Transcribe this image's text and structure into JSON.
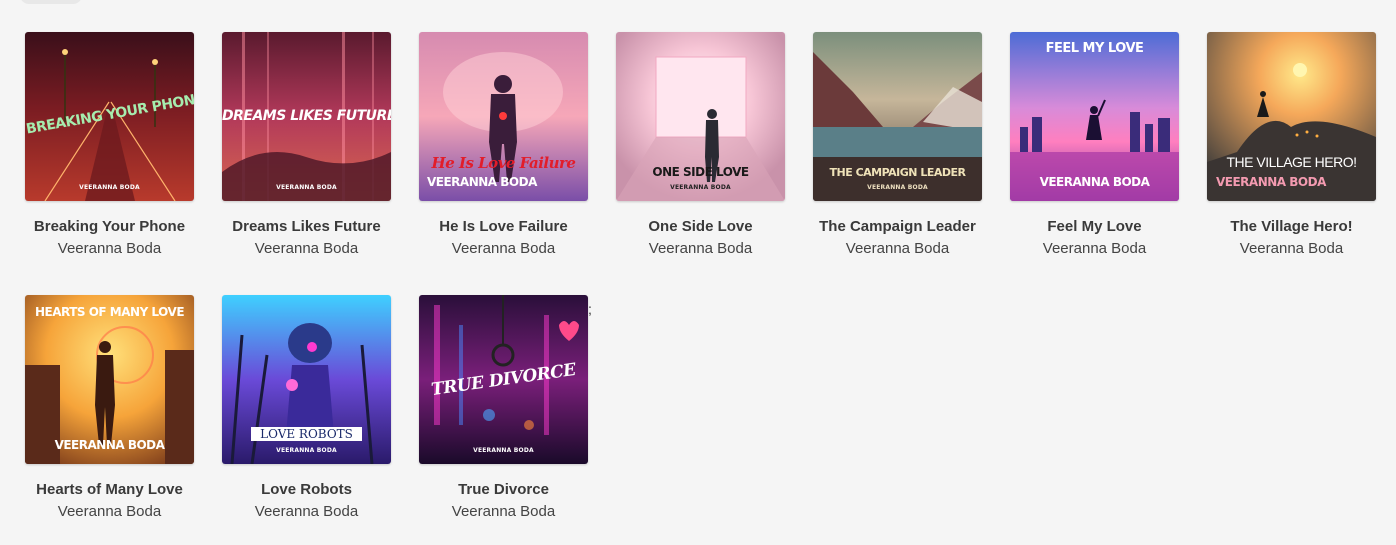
{
  "albums": [
    {
      "title": "Breaking Your Phone",
      "artist": "Veeranna Boda",
      "cover_text": "BREAKING YOUR PHONE",
      "cover_artist": "VEERANNA BODA"
    },
    {
      "title": "Dreams Likes Future",
      "artist": "Veeranna Boda",
      "cover_text": "DREAMS LIKES FUTURE",
      "cover_artist": "VEERANNA BODA"
    },
    {
      "title": "He Is Love Failure",
      "artist": "Veeranna Boda",
      "cover_text": "He Is Love Failure",
      "cover_artist": "VEERANNA BODA"
    },
    {
      "title": "One Side Love",
      "artist": "Veeranna Boda",
      "cover_text": "ONE SIDE LOVE",
      "cover_artist": "VEERANNA BODA"
    },
    {
      "title": "The Campaign Leader",
      "artist": "Veeranna Boda",
      "cover_text": "THE CAMPAIGN LEADER",
      "cover_artist": "VEERANNA BODA"
    },
    {
      "title": "Feel My Love",
      "artist": "Veeranna Boda",
      "cover_text": "FEEL MY LOVE",
      "cover_artist": "VEERANNA BODA"
    },
    {
      "title": "The Village Hero!",
      "artist": "Veeranna Boda",
      "cover_text": "THE VILLAGE HERO!",
      "cover_artist": "VEERANNA BODA"
    },
    {
      "title": "Hearts of Many Love",
      "artist": "Veeranna Boda",
      "cover_text": "HEARTS OF MANY LOVE",
      "cover_artist": "VEERANNA BODA"
    },
    {
      "title": "Love Robots",
      "artist": "Veeranna Boda",
      "cover_text": "LOVE ROBOTS",
      "cover_artist": "VEERANNA BODA"
    },
    {
      "title": "True Divorce",
      "artist": "Veeranna Boda",
      "cover_text": "TRUE DIVORCE",
      "cover_artist": "VEERANNA BODA"
    }
  ],
  "stray_char": ";"
}
